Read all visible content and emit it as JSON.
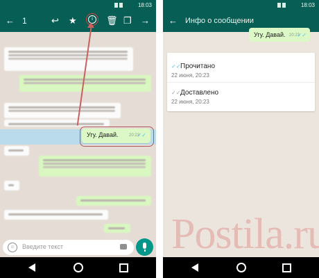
{
  "status_bar": {
    "time": "18:03"
  },
  "left": {
    "selected_count": "1",
    "toolbar_icons": [
      "back-arrow-icon",
      "reply-icon",
      "star-icon",
      "info-icon",
      "delete-icon",
      "copy-icon",
      "forward-icon"
    ],
    "highlighted_message": {
      "text": "Угу. Давай.",
      "time": "20:23",
      "ticks": "✓✓"
    },
    "input_placeholder": "Введите текст"
  },
  "right": {
    "title": "Инфо о сообщении",
    "message": {
      "text": "Угу. Давай.",
      "time": "20:23",
      "ticks": "✓✓"
    },
    "statuses": [
      {
        "label": "Прочитано",
        "date": "22 июня, 20:23",
        "ticks": "✓✓",
        "tick_color": "#4fc3f7"
      },
      {
        "label": "Доставлено",
        "date": "22 июня, 20:23",
        "ticks": "✓✓",
        "tick_color": "#9e9e9e"
      }
    ]
  },
  "watermark": "Postila.ru",
  "colors": {
    "appbar": "#075e54",
    "accent": "#009688",
    "outgoing_bubble": "#dcf8c6",
    "highlight": "#a9d9f1",
    "annotation": "#c96060"
  }
}
